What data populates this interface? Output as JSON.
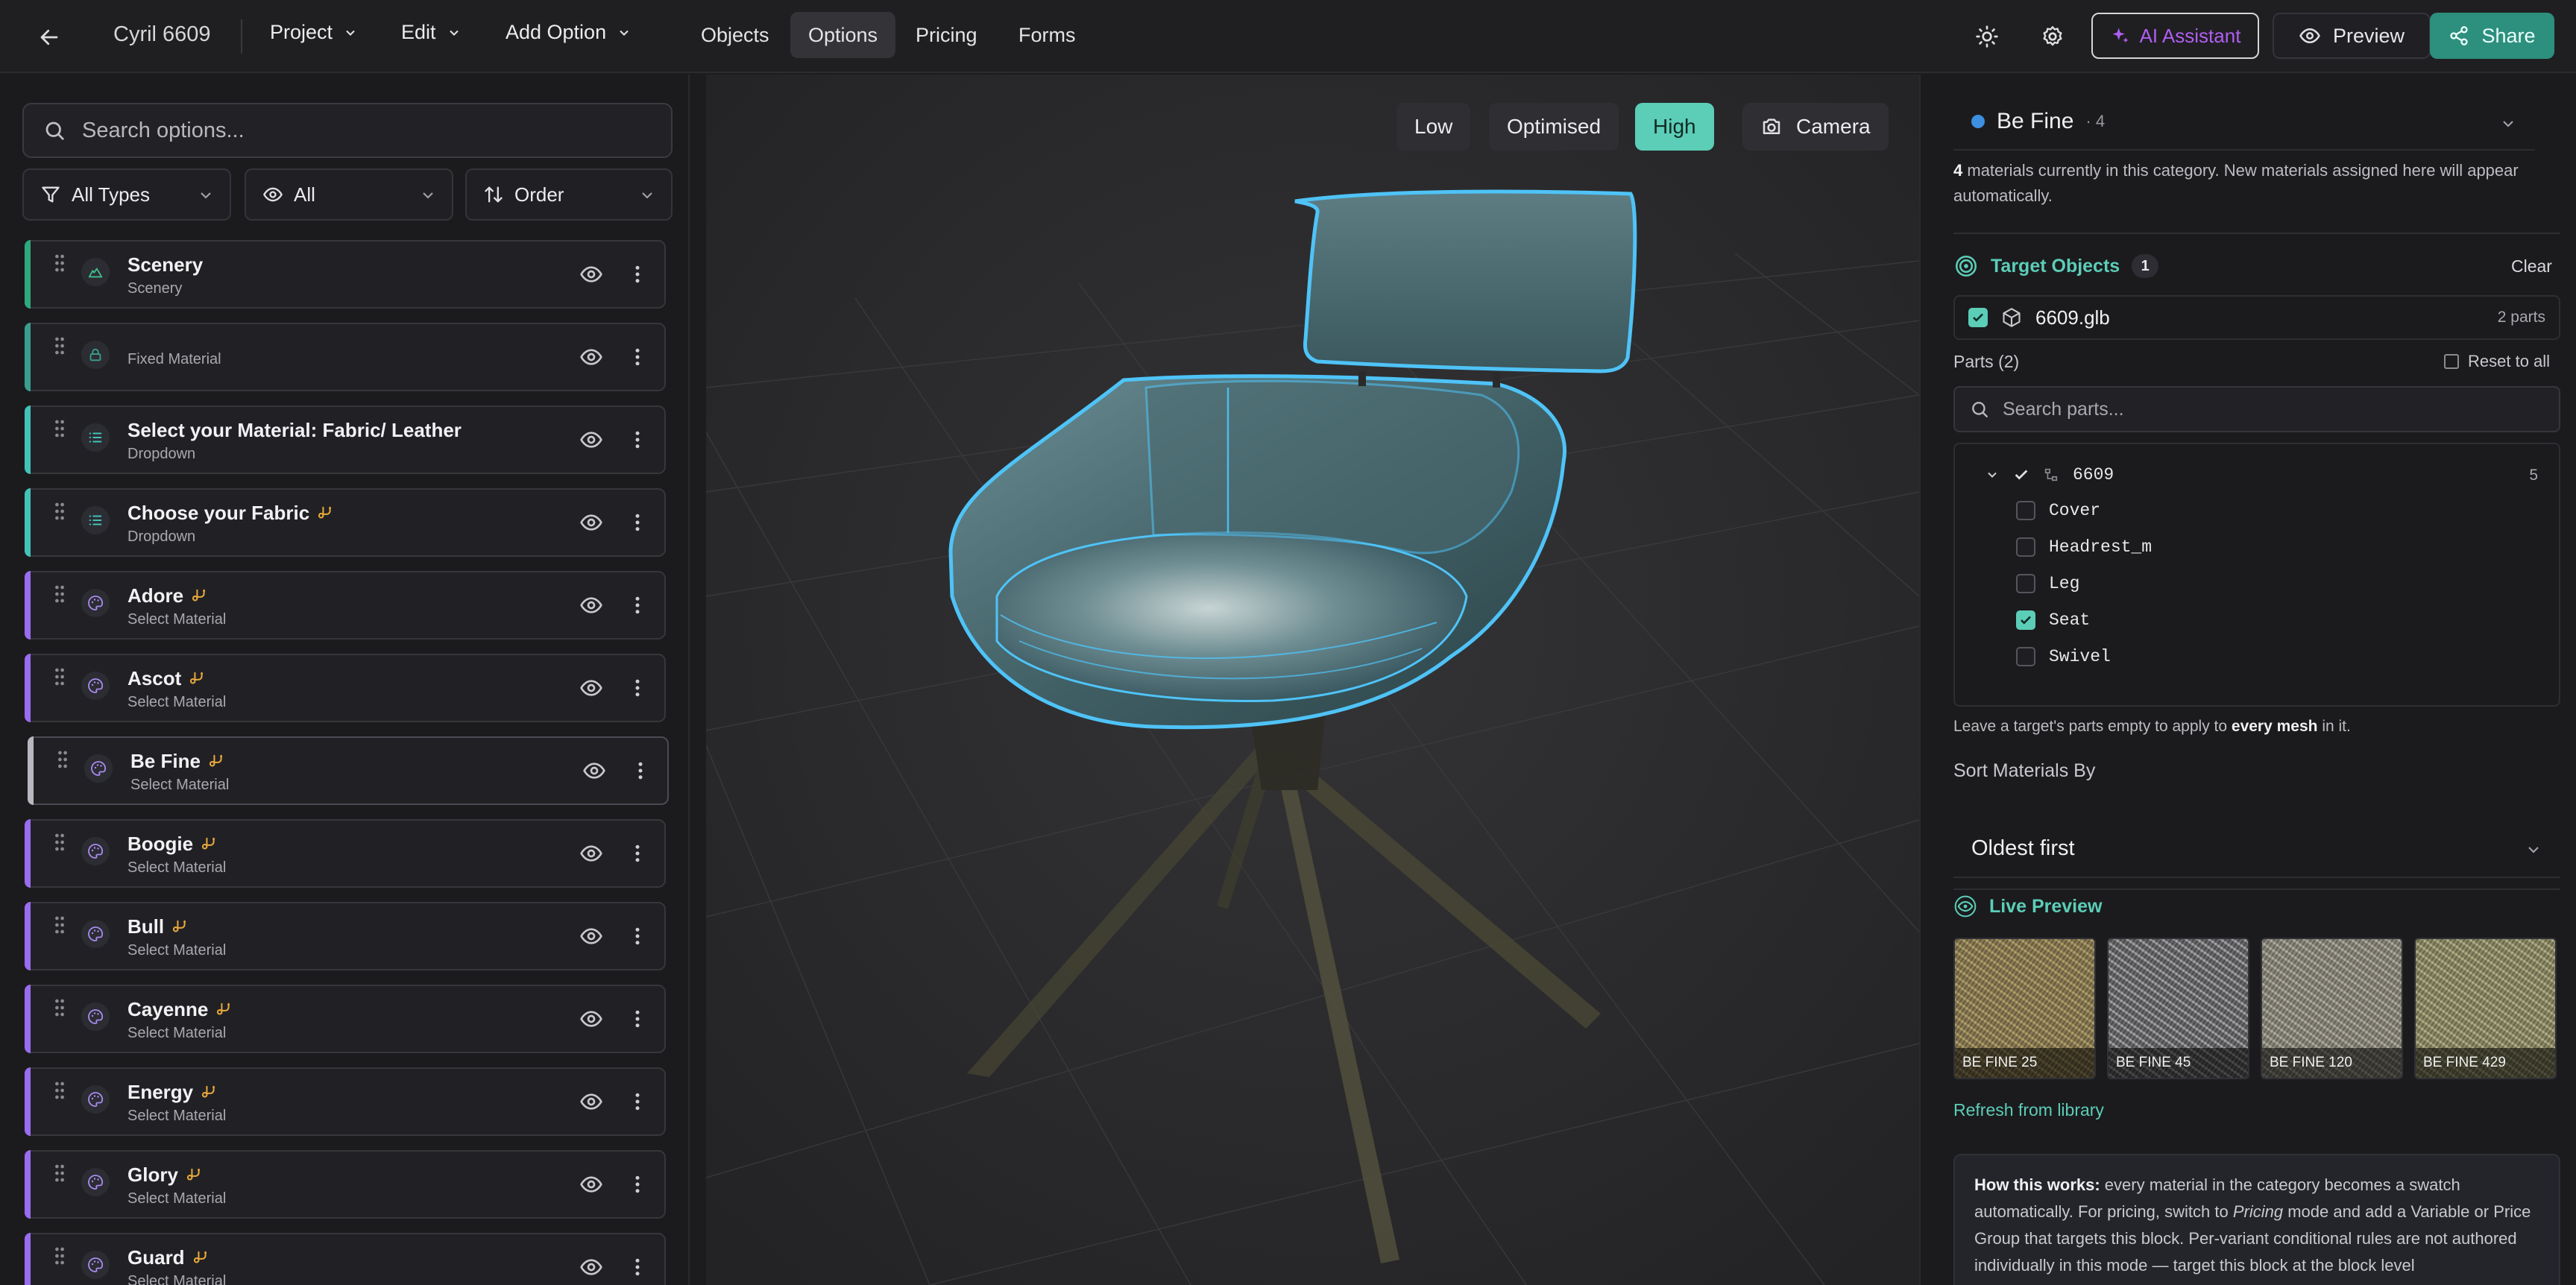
{
  "topbar": {
    "title": "Cyril 6609",
    "menus": [
      "Project",
      "Edit",
      "Add Option"
    ],
    "tabs": [
      "Objects",
      "Options",
      "Pricing",
      "Forms"
    ],
    "active_tab": "Options",
    "ai_label": "AI Assistant",
    "preview_label": "Preview",
    "share_label": "Share"
  },
  "left": {
    "search_placeholder": "Search options...",
    "filters": [
      "All Types",
      "All",
      "Order"
    ],
    "items": [
      {
        "name": "Scenery",
        "sub": "Scenery",
        "icon": "scenery",
        "color": "#2ea97d",
        "linked": false
      },
      {
        "name": "",
        "sub": "Fixed Material",
        "icon": "lock",
        "color": "#3a9e8e",
        "linked": false
      },
      {
        "name": "Select your Material: Fabric/ Leather",
        "sub": "Dropdown",
        "icon": "list",
        "color": "#43c2b8",
        "linked": false
      },
      {
        "name": "Choose your Fabric",
        "sub": "Dropdown",
        "icon": "list",
        "color": "#43c2b8",
        "linked": true
      },
      {
        "name": "Adore",
        "sub": "Select Material",
        "icon": "palette",
        "color": "#9a6cf0",
        "linked": true
      },
      {
        "name": "Ascot",
        "sub": "Select Material",
        "icon": "palette",
        "color": "#9a6cf0",
        "linked": true
      },
      {
        "name": "Be Fine",
        "sub": "Select Material",
        "icon": "palette",
        "color": "#b8b8c0",
        "linked": true
      },
      {
        "name": "Boogie",
        "sub": "Select Material",
        "icon": "palette",
        "color": "#9a6cf0",
        "linked": true
      },
      {
        "name": "Bull",
        "sub": "Select Material",
        "icon": "palette",
        "color": "#9a6cf0",
        "linked": true
      },
      {
        "name": "Cayenne",
        "sub": "Select Material",
        "icon": "palette",
        "color": "#9a6cf0",
        "linked": true
      },
      {
        "name": "Energy",
        "sub": "Select Material",
        "icon": "palette",
        "color": "#9a6cf0",
        "linked": true
      },
      {
        "name": "Glory",
        "sub": "Select Material",
        "icon": "palette",
        "color": "#9a6cf0",
        "linked": true
      },
      {
        "name": "Guard",
        "sub": "Select Material",
        "icon": "palette",
        "color": "#9a6cf0",
        "linked": true
      }
    ]
  },
  "viewport": {
    "quality": [
      "Low",
      "Optimised",
      "High"
    ],
    "active_quality": "High",
    "camera_label": "Camera"
  },
  "right": {
    "category_name": "Be Fine",
    "category_count": "· 4",
    "category_note_count": "4",
    "category_note": " materials currently in this category. New materials assigned here will appear automatically.",
    "targets_title": "Target Objects",
    "targets_count": "1",
    "clear_label": "Clear",
    "target_file": "6609.glb",
    "target_parts": "2 parts",
    "parts_label": "Parts (2)",
    "reset_label": "Reset to all",
    "parts_search_placeholder": "Search parts...",
    "tree_root": "6609",
    "tree_root_count": "5",
    "parts": [
      {
        "name": "Cover",
        "checked": false
      },
      {
        "name": "Headrest_m",
        "checked": false
      },
      {
        "name": "Leg",
        "checked": false
      },
      {
        "name": "Seat",
        "checked": true
      },
      {
        "name": "Swivel",
        "checked": false
      }
    ],
    "hint_pre": "Leave a target's parts empty to apply to ",
    "hint_bold": "every mesh",
    "hint_post": " in it.",
    "sort_label": "Sort Materials By",
    "sort_value": "Oldest first",
    "live_title": "Live Preview",
    "swatches": [
      {
        "label": "BE FINE 25",
        "c1": "#7d6e48",
        "c2": "#a8975f"
      },
      {
        "label": "BE FINE 45",
        "c1": "#5a5a5c",
        "c2": "#9a9a9c"
      },
      {
        "label": "BE FINE 120",
        "c1": "#7c7a6e",
        "c2": "#a8a596"
      },
      {
        "label": "BE FINE 429",
        "c1": "#7e7c58",
        "c2": "#aaa87e"
      }
    ],
    "refresh_label": "Refresh from library",
    "how_bold": "How this works:",
    "how_1": " every material in the category becomes a swatch automatically. For pricing, switch to ",
    "how_em": "Pricing",
    "how_2": " mode and add a Variable or Price Group that targets this block. Per-variant conditional rules are not authored individually in this mode — target this block at the block level"
  },
  "colors": {
    "accent": "#5ccdb7",
    "share": "#2d8f7e",
    "ai": "#b05ef0",
    "highlight": "#4fc3f7"
  }
}
